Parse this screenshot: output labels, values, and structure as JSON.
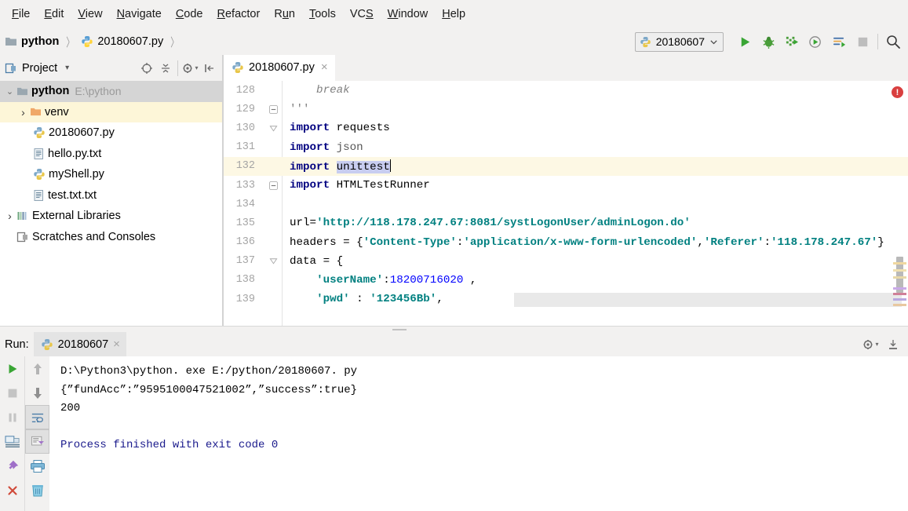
{
  "menu": {
    "items": [
      {
        "label": "File",
        "mnemonic": "F"
      },
      {
        "label": "Edit",
        "mnemonic": "E"
      },
      {
        "label": "View",
        "mnemonic": "V"
      },
      {
        "label": "Navigate",
        "mnemonic": "N"
      },
      {
        "label": "Code",
        "mnemonic": "C"
      },
      {
        "label": "Refactor",
        "mnemonic": "R"
      },
      {
        "label": "Run",
        "mnemonic": "u"
      },
      {
        "label": "Tools",
        "mnemonic": "T"
      },
      {
        "label": "VCS",
        "mnemonic": "S"
      },
      {
        "label": "Window",
        "mnemonic": "W"
      },
      {
        "label": "Help",
        "mnemonic": "H"
      }
    ]
  },
  "breadcrumb": {
    "project": "python",
    "file": "20180607.py",
    "separator": "〉"
  },
  "toolbar": {
    "run_config": "20180607",
    "dropdown_caret": "⌄",
    "buttons": [
      {
        "name": "run-button",
        "label": "Run"
      },
      {
        "name": "debug-button",
        "label": "Debug"
      },
      {
        "name": "run-coverage-button",
        "label": "Run with Coverage"
      },
      {
        "name": "profile-button",
        "label": "Profile"
      },
      {
        "name": "attach-button",
        "label": "Attach to Process"
      },
      {
        "name": "stop-button",
        "label": "Stop"
      },
      {
        "name": "search-everywhere-button",
        "label": "Search Everywhere"
      }
    ]
  },
  "project_panel": {
    "title": "Project",
    "title_caret": "▾",
    "icons": [
      {
        "name": "select-opened-file-icon",
        "label": "Select Opened File"
      },
      {
        "name": "collapse-all-icon",
        "label": "Collapse All"
      },
      {
        "name": "settings-gear-icon",
        "label": "Settings"
      },
      {
        "name": "hide-panel-icon",
        "label": "Hide"
      }
    ],
    "tree": [
      {
        "label": "python",
        "sub": "E:\\python",
        "icon": "folder-icon",
        "twisty": "⌄",
        "depth": 0,
        "bold": true,
        "state": "sel-grey"
      },
      {
        "label": "venv",
        "sub": "",
        "icon": "folder-orange-icon",
        "twisty": "›",
        "depth": 1,
        "bold": false,
        "state": "sel-yellow"
      },
      {
        "label": "20180607.py",
        "sub": "",
        "icon": "python-file-icon",
        "twisty": "",
        "depth": 2,
        "bold": false,
        "state": ""
      },
      {
        "label": "hello.py.txt",
        "sub": "",
        "icon": "text-file-icon",
        "twisty": "",
        "depth": 2,
        "bold": false,
        "state": ""
      },
      {
        "label": "myShell.py",
        "sub": "",
        "icon": "python-file-icon",
        "twisty": "",
        "depth": 2,
        "bold": false,
        "state": ""
      },
      {
        "label": "test.txt.txt",
        "sub": "",
        "icon": "text-file-icon",
        "twisty": "",
        "depth": 2,
        "bold": false,
        "state": ""
      },
      {
        "label": "External Libraries",
        "sub": "",
        "icon": "libraries-icon",
        "twisty": "›",
        "depth": 0,
        "bold": false,
        "state": ""
      },
      {
        "label": "Scratches and Consoles",
        "sub": "",
        "icon": "scratches-icon",
        "twisty": "",
        "depth": 0,
        "bold": false,
        "state": ""
      }
    ]
  },
  "editor": {
    "tab_label": "20180607.py",
    "tab_close": "×",
    "error_badge": "!",
    "lines": [
      {
        "num": "128",
        "fold": "",
        "indent": 4,
        "tokens": [
          {
            "t": "break",
            "c": "italic-gray"
          }
        ],
        "highlight": false
      },
      {
        "num": "129",
        "fold": "minus",
        "indent": 0,
        "tokens": [
          {
            "t": "'''",
            "c": "cmt"
          }
        ],
        "highlight": false
      },
      {
        "num": "130",
        "fold": "down",
        "indent": 0,
        "tokens": [
          {
            "t": "import",
            "c": "kw"
          },
          {
            "t": " requests",
            "c": ""
          }
        ],
        "highlight": false
      },
      {
        "num": "131",
        "fold": "",
        "indent": 0,
        "tokens": [
          {
            "t": "import",
            "c": "kw"
          },
          {
            "t": " ",
            "c": ""
          },
          {
            "t": "json",
            "c": "mod"
          }
        ],
        "highlight": false
      },
      {
        "num": "132",
        "fold": "",
        "indent": 0,
        "tokens": [
          {
            "t": "import",
            "c": "kw"
          },
          {
            "t": " ",
            "c": ""
          },
          {
            "t": "unittest",
            "c": "sel-tok"
          },
          {
            "t": "CARET",
            "c": "caret"
          }
        ],
        "highlight": true
      },
      {
        "num": "133",
        "fold": "minus",
        "indent": 0,
        "tokens": [
          {
            "t": "import",
            "c": "kw"
          },
          {
            "t": " HTMLTestRunner",
            "c": ""
          }
        ],
        "highlight": false
      },
      {
        "num": "134",
        "fold": "",
        "indent": 0,
        "tokens": [],
        "highlight": false
      },
      {
        "num": "135",
        "fold": "",
        "indent": 0,
        "tokens": [
          {
            "t": "url=",
            "c": ""
          },
          {
            "t": "'http://118.178.247.67:8081/systLogonUser/adminLogon.do'",
            "c": "str"
          }
        ],
        "highlight": false
      },
      {
        "num": "136",
        "fold": "",
        "indent": 0,
        "tokens": [
          {
            "t": "headers = {",
            "c": ""
          },
          {
            "t": "'Content-Type'",
            "c": "str"
          },
          {
            "t": ":",
            "c": ""
          },
          {
            "t": "'application/x-www-form-urlencoded'",
            "c": "str"
          },
          {
            "t": ",",
            "c": ""
          },
          {
            "t": "'Referer'",
            "c": "str"
          },
          {
            "t": ":",
            "c": ""
          },
          {
            "t": "'118.178.247.67'",
            "c": "str"
          },
          {
            "t": "}",
            "c": ""
          }
        ],
        "highlight": false
      },
      {
        "num": "137",
        "fold": "down",
        "indent": 0,
        "tokens": [
          {
            "t": "data = {",
            "c": ""
          }
        ],
        "highlight": false
      },
      {
        "num": "138",
        "fold": "",
        "indent": 4,
        "tokens": [
          {
            "t": "'userName'",
            "c": "str"
          },
          {
            "t": ":",
            "c": ""
          },
          {
            "t": "18200716020",
            "c": "num"
          },
          {
            "t": " ,",
            "c": ""
          }
        ],
        "highlight": false
      },
      {
        "num": "139",
        "fold": "",
        "indent": 4,
        "tokens": [
          {
            "t": "'pwd'",
            "c": "str"
          },
          {
            "t": " : ",
            "c": ""
          },
          {
            "t": "'123456Bb'",
            "c": "str"
          },
          {
            "t": ",",
            "c": ""
          }
        ],
        "highlight": false
      }
    ],
    "minimap_colors": [
      "#c9a9e8",
      "#f0d8a0",
      "#c8a0c8",
      "#b8a8e0",
      "#d9b0c0",
      "#e8c8a0",
      "#c0b8e8"
    ]
  },
  "run_panel": {
    "label": "Run:",
    "tab_label": "20180607",
    "tab_close": "×",
    "header_icons": [
      {
        "name": "settings-gear-icon",
        "label": "Settings"
      },
      {
        "name": "minimize-panel-icon",
        "label": "Hide"
      }
    ],
    "side_buttons": [
      {
        "name": "rerun-button",
        "label": "Rerun"
      },
      {
        "name": "stop-button",
        "label": "Stop"
      },
      {
        "name": "pause-button",
        "label": "Pause Output"
      },
      {
        "name": "console-button",
        "label": "Console"
      },
      {
        "name": "pin-tab-button",
        "label": "Pin Tab"
      },
      {
        "name": "close-button",
        "label": "Close"
      }
    ],
    "side_buttons2": [
      {
        "name": "up-stacktrace-button",
        "label": "Up the Stack Trace"
      },
      {
        "name": "down-stacktrace-button",
        "label": "Down the Stack Trace"
      },
      {
        "name": "soft-wrap-button",
        "label": "Use Soft Wraps"
      },
      {
        "name": "scroll-to-end-button",
        "label": "Scroll to End"
      },
      {
        "name": "print-button",
        "label": "Print"
      },
      {
        "name": "clear-all-button",
        "label": "Clear All"
      }
    ],
    "console_lines": [
      {
        "text": "D:\\Python3\\python. exe E:/python/20180607. py",
        "color": "plain"
      },
      {
        "text": "{”fundAcc”:”9595100047521002”,”success”:true}",
        "color": "plain"
      },
      {
        "text": "200",
        "color": "plain"
      },
      {
        "text": "",
        "color": "plain"
      },
      {
        "text": "Process finished with exit code 0",
        "color": "blue"
      }
    ]
  },
  "colors": {
    "accent_green": "#4aa033",
    "keyword": "#000080",
    "string": "#008080",
    "number": "#0000ff",
    "selection": "#c8cdf0",
    "line_highlight": "#fdf8e4",
    "tree_selected": "#d5d5d5",
    "tree_hover": "#fdf6d8",
    "error_red": "#d93f3f"
  }
}
